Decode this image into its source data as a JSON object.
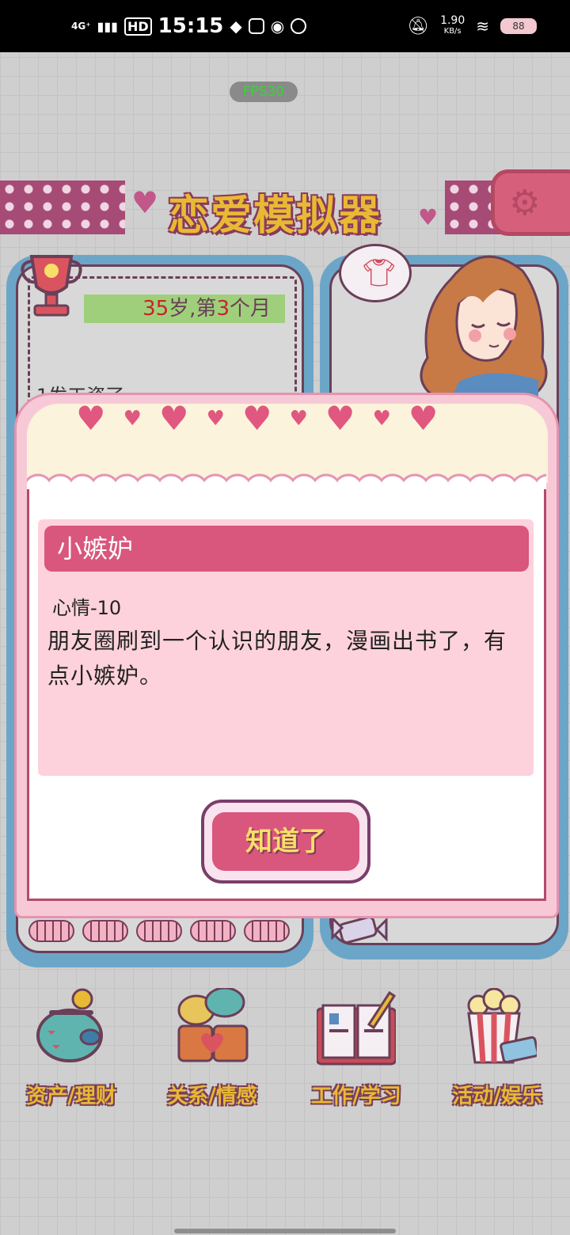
{
  "status_bar": {
    "network": "4G⁺",
    "time": "15:15",
    "hd": "HD",
    "speed_value": "1.90",
    "speed_unit": "KB/s",
    "battery": "88"
  },
  "fps_badge": "FPS30",
  "game_title": "恋爱模拟器",
  "age_bar": {
    "age_number": "35",
    "age_unit": "岁,第",
    "month_number": "3",
    "month_unit": "个月"
  },
  "log_preview": "1发工资了",
  "modal": {
    "event_title": "小嫉妒",
    "effect": "心情-10",
    "description": "朋友圈刷到一个认识的朋友，漫画出书了，有点小嫉妒。",
    "confirm_label": "知道了"
  },
  "bottom_nav": [
    {
      "label": "资产/理财",
      "icon": "piggy-bank-icon"
    },
    {
      "label": "关系/情感",
      "icon": "coffee-cups-icon"
    },
    {
      "label": "工作/学习",
      "icon": "book-icon"
    },
    {
      "label": "活动/娱乐",
      "icon": "popcorn-icon"
    }
  ],
  "colors": {
    "accent_pink": "#d9567d",
    "card_pink": "#fdd2dc",
    "title_yellow": "#e8b935",
    "panel_blue": "#6ba6c8"
  }
}
